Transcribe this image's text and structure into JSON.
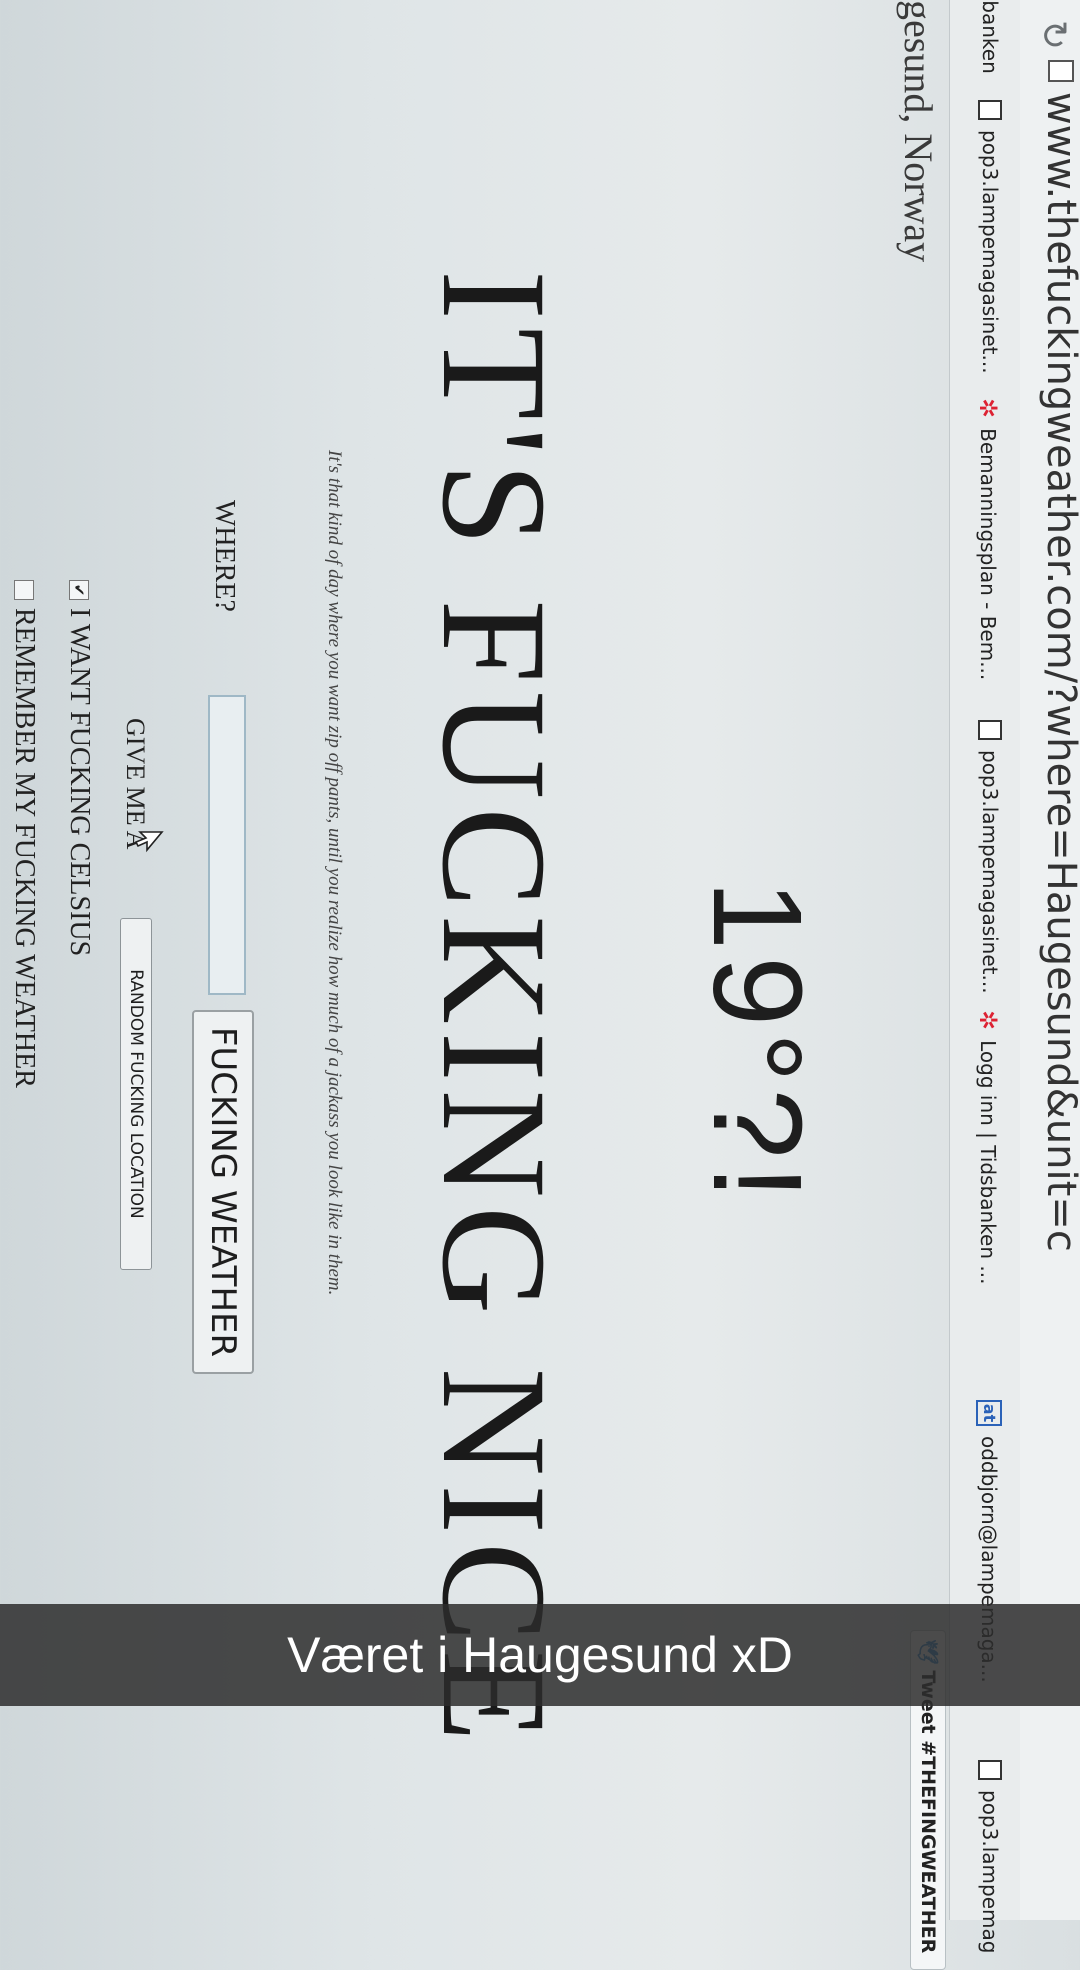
{
  "browser": {
    "url": "www.thefuckingweather.com/?where=Haugesund&unit=c",
    "bookmarks": [
      {
        "label": "Tidsbanken",
        "icon": "none"
      },
      {
        "label": "pop3.lampemagasinet...",
        "icon": "page-icon"
      },
      {
        "label": "Bemanningsplan - Bem...",
        "icon": "star-logo-icon"
      },
      {
        "label": "pop3.lampemagasinet...",
        "icon": "page-icon"
      },
      {
        "label": "Logg inn | Tidsbanken ...",
        "icon": "star-logo-icon"
      },
      {
        "label": "oddbjorn@lampemaga...",
        "icon": "at-icon"
      },
      {
        "label": "pop3.lampemag",
        "icon": "page-icon"
      }
    ]
  },
  "site": {
    "tweet_label": "Tweet #THEFINGWEATHER",
    "location": "ugesund, Norway",
    "temperature": "19°?!",
    "headline": "IT'S FUCKING NICE",
    "flavor_text": "It's that kind of day where you want zip off pants, until you realize how much of a jackass you look like in them.",
    "form": {
      "where_label": "WHERE?",
      "where_value": "",
      "submit_label": "FUCKING WEATHER",
      "random_prefix": "GIVE ME A",
      "random_button": "RANDOM FUCKING LOCATION",
      "celsius_label": "I WANT FUCKING CELSIUS",
      "celsius_checked": true,
      "remember_label": "REMEMBER MY FUCKING WEATHER",
      "remember_checked": false
    }
  },
  "caption": "Været i Haugesund xD"
}
